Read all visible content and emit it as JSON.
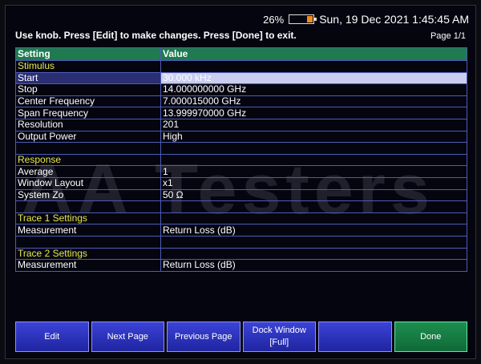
{
  "status": {
    "battery_percent": "26%",
    "battery_level": 0.26,
    "datetime": "Sun, 19 Dec 2021 1:45:45 AM"
  },
  "instructions": "Use knob. Press [Edit] to make changes. Press [Done] to exit.",
  "page_indicator": "Page 1/1",
  "table": {
    "headers": [
      "Setting",
      "Value"
    ],
    "rows": [
      {
        "type": "section",
        "setting": "Stimulus",
        "value": ""
      },
      {
        "type": "selected",
        "setting": "Start",
        "value": "30.000 kHz"
      },
      {
        "type": "row",
        "setting": "Stop",
        "value": "14.000000000 GHz"
      },
      {
        "type": "row",
        "setting": "Center Frequency",
        "value": "7.000015000 GHz"
      },
      {
        "type": "row",
        "setting": "Span Frequency",
        "value": "13.999970000 GHz"
      },
      {
        "type": "row",
        "setting": "Resolution",
        "value": "201"
      },
      {
        "type": "row",
        "setting": "Output Power",
        "value": "High"
      },
      {
        "type": "blank",
        "setting": "",
        "value": ""
      },
      {
        "type": "section",
        "setting": "Response",
        "value": ""
      },
      {
        "type": "row",
        "setting": "Average",
        "value": "1"
      },
      {
        "type": "row",
        "setting": "Window Layout",
        "value": "x1"
      },
      {
        "type": "row",
        "setting": "System Zo",
        "value": "50 Ω"
      },
      {
        "type": "blank",
        "setting": "",
        "value": ""
      },
      {
        "type": "section",
        "setting": "Trace 1 Settings",
        "value": ""
      },
      {
        "type": "row",
        "setting": "Measurement",
        "value": "Return Loss (dB)"
      },
      {
        "type": "blank",
        "setting": "",
        "value": ""
      },
      {
        "type": "section",
        "setting": "Trace 2 Settings",
        "value": ""
      },
      {
        "type": "row",
        "setting": "Measurement",
        "value": "Return Loss (dB)"
      }
    ]
  },
  "watermark": "AA Testers",
  "softkeys": {
    "edit": "Edit",
    "next_page": "Next Page",
    "previous_page": "Previous Page",
    "dock_window_line1": "Dock Window",
    "dock_window_line2": "[Full]",
    "blank": "",
    "done": "Done"
  },
  "colors": {
    "header_green": "#1f7a4f",
    "section_yellow": "#e8e84a",
    "grid_blue": "#4e5bb5",
    "softkey_blue": "#2a30c0",
    "done_green": "#1d8e4f",
    "battery_orange": "#f08a1e"
  }
}
